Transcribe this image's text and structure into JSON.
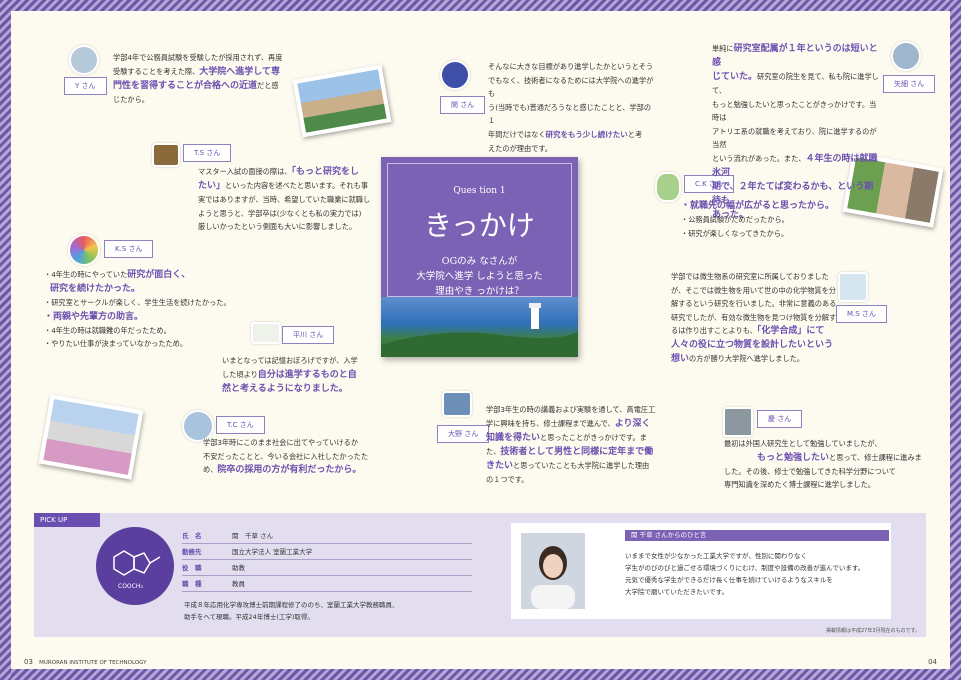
{
  "q1": {
    "question_num": "Ques tion 1",
    "title": "きっかけ",
    "sub1": "OGのみ なさんが",
    "sub2": "大学院へ進学 しようと思った",
    "sub3": "理由やき っかけは？"
  },
  "items": {
    "y": {
      "tag": "Y さん",
      "l1": "学部4年で公務員試験を受験したが採用されず、再度",
      "l2": "受験することを考えた際、",
      "h1": "大学院へ進学して専",
      "h2": "門性を習得することが合格への近道",
      "l3": "だと感",
      "l4": "じたから。"
    },
    "seki": {
      "tag": "関 さん",
      "l1": "そんなに大きな目標があり進学したかというとそう",
      "l2": "でもなく、技術者になるためには大学院への進学がも",
      "l3": "う(当時でも)普通だろうなと感じたことと、学部の１",
      "l4": "年間だけではなく",
      "h1": "研究をもう少し続けたい",
      "l5": "と考",
      "l6": "えたのが理由です。"
    },
    "yagi": {
      "tag": "矢細 さん",
      "l1": "単純に",
      "h1": "研究室配属が１年というのは短いと感",
      "h2": "じていた。",
      "l2": "研究室の院生を見て、私も院に進学して、",
      "l3": "もっと勉強したいと思ったことがきっかけです。当時は",
      "l4": "アトリエ系の就職を考えており、院に進学するのが当然",
      "l5": "という流れがあった。また、",
      "h3": "４年生の時は就職氷河",
      "h4": "期で、２年たてば変わるかも、という期待も",
      "h5": "あった。"
    },
    "ts": {
      "tag": "T.S さん",
      "l1": "マスター入試の面接の際は、",
      "h1": "「もっと研究をし",
      "h2": "たい」",
      "l2": "といった内容を述べたと思います。それも事",
      "l3": "実ではありますが、当時、希望していた職業に就職し",
      "l4": "ようと思うと、学部卒は(少なくとも私の実力では)",
      "l5": "厳しいかったという側面も大いに影響しました。"
    },
    "ck": {
      "tag": "C.K さん",
      "b1": "・就職先の幅が広がると思ったから。",
      "b2": "・公務員試験がだめだったから。",
      "b3": "・研究が楽しくなってきたから。"
    },
    "ks": {
      "tag": "K.S さん",
      "b1a": "・4年生の時にやっていた",
      "b1b": "研究が面白く、",
      "b1c": "研究を続けたかった。",
      "b2": "・研究室とサークルが楽しく、学生生活を続けたかった。",
      "b3": "・両親や先輩方の助言。",
      "b4": "・4年生の時は就職難の年だったため。",
      "b5": "・やりたい仕事が決まっていなかったため。"
    },
    "ms": {
      "tag": "M.S さん",
      "l1": "学部では微生物系の研究室に所属しておりました",
      "l2": "が、そこでは微生物を用いて世の中の化学物質を分",
      "l3": "解するという研究を行いました。非常に意義のある",
      "l4": "研究でしたが、有効な微生物を見つけ物質を分解す",
      "l5": "るは作り出すことよりも、",
      "h1": "「化学合成」にて",
      "h2": "人々の役に立つ物質を設計したいという",
      "h3": "想い",
      "l6": "の方が勝り大学院へ進学しました。"
    },
    "hira": {
      "tag": "平川 さん",
      "l1": "いまとなっては記憶おぼろげですが、入学",
      "l2": "した頃より",
      "h1": "自分は進学するものと自",
      "h2": "然と考えるようになりました。"
    },
    "ono": {
      "tag": "大野 さん",
      "l1": "学部3年生の時の講義および実験を通して、高電圧工",
      "l2": "学に興味を持ち、修士課程まで進んで、",
      "h1": "より深く",
      "h2": "知識を得たい",
      "l3": "と思ったことがきっかけです。ま",
      "l4": "た、",
      "h3": "技術者として男性と同様に定年まで働",
      "h4": "きたい",
      "l5": "と思っていたことも大学院に進学した理由",
      "l6": "の１つです。"
    },
    "tc": {
      "tag": "T.C さん",
      "l1": "学部3年時にこのまま社会に出てやっていけるか",
      "l2": "不安だったことと、今いる会社に入社したかったた",
      "l3": "め、",
      "h1": "院卒の採用の方が有利だったから。"
    },
    "kei": {
      "tag": "慶 さん",
      "l1": "最初は外国人研究生として勉強していましたが、",
      "h1": "もっと勉強したい",
      "l2": "と思って、修士課程に進みま",
      "l3": "した。その後、修士で勉強してきた科学分野について",
      "l4": "専門知識を深めたく博士課程に進学しました。"
    }
  },
  "pickup": {
    "badge": "PICK UP",
    "emblem_text": "COOCH₃",
    "rows": [
      {
        "k": "氏　名",
        "v": "関　千草 さん"
      },
      {
        "k": "勤務先",
        "v": "国立大学法人 室蘭工業大学"
      },
      {
        "k": "役　職",
        "v": "助教"
      },
      {
        "k": "職　種",
        "v": "教員"
      }
    ],
    "career1": "平成８年応用化学専攻博士前期課程修了ののち、室蘭工業大学教務職員、",
    "career2": "助手をへて現職。平成24年博士(工学)取得。",
    "msg_head": "関 千草 さんからのひと言",
    "m1": "いままで女性が少なかった工業大学ですが、性別に関わりなく",
    "m2": "学生がのびのびと過ごせる環境づくりにむけ、制度や設備の改善が進んでいます。",
    "m3": "元気で優秀な学生ができるだけ長く仕事を続けていけるようなスキルを",
    "m4": "大学院で磨いていただきたいです。",
    "note": "掲載情報は平成27年3月現在のものです。"
  },
  "footer": {
    "left_num": "03",
    "left_text": "MURORAN INSTITUTE OF TECHNOLOGY",
    "right_num": "04"
  }
}
